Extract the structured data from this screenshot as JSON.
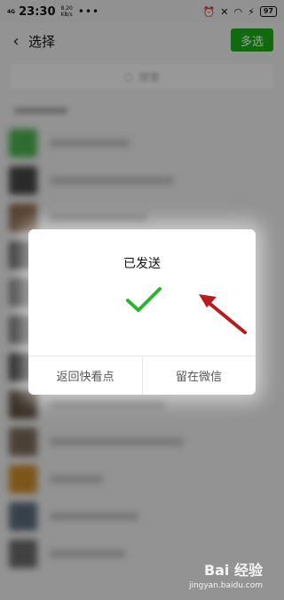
{
  "status": {
    "network": "4G",
    "time": "23:30",
    "speed_value": "8.20",
    "speed_unit": "KB/s",
    "dots": "•••",
    "battery": "97"
  },
  "header": {
    "title": "选择",
    "multi_select_label": "多选"
  },
  "search": {
    "placeholder": "搜索"
  },
  "dialog": {
    "title": "已发送",
    "left_button": "返回快看点",
    "right_button": "留在微信"
  },
  "colors": {
    "accent_green": "#1aad19",
    "check_green": "#2fb22f",
    "arrow_red": "#b71c1c"
  },
  "icons": {
    "back": "chevron-left-icon",
    "check": "checkmark-icon",
    "arrow": "red-arrow-icon"
  },
  "watermark": {
    "brand": "Bai 经验",
    "url": "jingyan.baidu.com"
  }
}
